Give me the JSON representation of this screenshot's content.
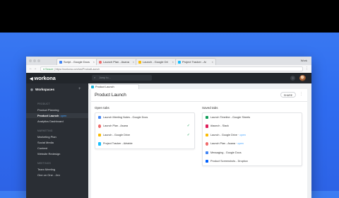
{
  "browser": {
    "tabs": [
      {
        "label": "Script - Google Docs",
        "icon": "docs-icon",
        "color": "#4285f4"
      },
      {
        "label": "Launch Plan - Asana",
        "icon": "asana-icon",
        "color": "#f06a6a"
      },
      {
        "label": "Launch - Google Dri",
        "icon": "drive-icon",
        "color": "#fbbc04"
      },
      {
        "label": "Project Tracker - Ai",
        "icon": "airtable-icon",
        "color": "#18bfff"
      }
    ],
    "user_label": "Work",
    "url_secure": "Secure",
    "url": "https://workona.com/ws/ProductLaunch"
  },
  "app": {
    "logo": "workona",
    "search_placeholder": "Jump to...",
    "help_label": "?"
  },
  "sidebar": {
    "workspaces_label": "Workspaces",
    "sections": [
      {
        "label": "PRODUCT",
        "items": [
          {
            "label": "Product Planning"
          },
          {
            "label": "Product Launch",
            "open": "open"
          },
          {
            "label": "Analytics Dashboard"
          }
        ]
      },
      {
        "label": "MARKETING",
        "items": [
          {
            "label": "Marketing Plan"
          },
          {
            "label": "Social Media"
          },
          {
            "label": "Content"
          },
          {
            "label": "Website Redesign"
          }
        ]
      },
      {
        "label": "MEETINGS",
        "items": [
          {
            "label": "Team Meeting"
          },
          {
            "label": "One on One - Jen"
          }
        ]
      }
    ]
  },
  "main": {
    "tab_label": "Product Launch",
    "title": "Product Launch",
    "share_label": "SHARE",
    "open_tabs_label": "Open tabs",
    "saved_tabs_label": "Saved tabs",
    "open_tabs": [
      {
        "label": "Launch Meeting Notes - Google Docs",
        "icon": "docs-icon",
        "color": "#4285f4",
        "checked": false
      },
      {
        "label": "Launch Plan - Asana",
        "icon": "asana-icon",
        "color": "#f06a6a",
        "checked": true
      },
      {
        "label": "Launch - Google Drive",
        "icon": "drive-icon",
        "color": "#fbbc04",
        "checked": true
      },
      {
        "label": "Project Tracker - Airtable",
        "icon": "airtable-icon",
        "color": "#18bfff",
        "checked": false
      }
    ],
    "saved_tabs": [
      {
        "label": "Launch Timeline - Google Sheets",
        "icon": "sheets-icon",
        "color": "#0f9d58",
        "via": ""
      },
      {
        "label": "#launch - Slack",
        "icon": "slack-icon",
        "color": "#e01e5a",
        "via": ""
      },
      {
        "label": "Launch - Google Drive",
        "icon": "drive-icon",
        "color": "#fbbc04",
        "via": "open"
      },
      {
        "label": "Launch Plan - Asana",
        "icon": "asana-icon",
        "color": "#f06a6a",
        "via": "open"
      },
      {
        "label": "Messaging - Google Docs",
        "icon": "docs-icon",
        "color": "#4285f4",
        "via": ""
      },
      {
        "label": "Product Screenshots - Dropbox",
        "icon": "dropbox-icon",
        "color": "#0061ff",
        "via": ""
      }
    ]
  }
}
